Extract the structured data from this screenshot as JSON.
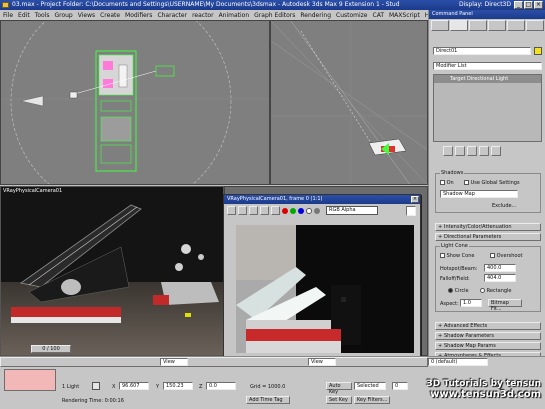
{
  "window": {
    "title": "03.max - Project Folder: C:\\Documents and Settings\\USERNAME\\My Documents\\3dsmax - Autodesk 3ds Max 9 Extension 1 - Stud",
    "display": "Display: Direct3D",
    "controls": [
      "_",
      "□",
      "×"
    ]
  },
  "menu": {
    "items": [
      "File",
      "Edit",
      "Tools",
      "Group",
      "Views",
      "Create",
      "Modifiers",
      "Character",
      "reactor",
      "Animation",
      "Graph Editors",
      "Rendering",
      "Customize",
      "CAT",
      "MAXScript",
      "Help"
    ]
  },
  "viewports": {
    "camera_label": "VRayPhysicalCamera01",
    "frame_slider": "0 / 100"
  },
  "vfb": {
    "title": "VRayPhysicalCamera01, frame 0 (1:1)",
    "channel": "RGB Alpha",
    "close": "×"
  },
  "command_panel": {
    "title": "Command Panel",
    "object_name": "Direct01",
    "modifier_list": "Modifier List",
    "stack_item": "Target Directional Light",
    "shadows": {
      "header": "Shadows",
      "on_label": "On",
      "global_label": "Use Global Settings",
      "type": "Shadow Map",
      "exclude": "Exclude..."
    },
    "rollouts": {
      "intensity": "Intensity/Color/Attenuation",
      "directional_params": "Directional Parameters",
      "advanced": "Advanced Effects",
      "shadow_params": "Shadow Parameters",
      "shadow_map": "Shadow Map Params",
      "atmospheres": "Atmospheres & Effects"
    },
    "light_cone": {
      "header": "Light Cone",
      "show_cone": "Show Cone",
      "overshoot": "Overshoot",
      "hotspot_label": "Hotspot/Beam:",
      "hotspot_value": "400.0",
      "falloff_label": "Falloff/Field:",
      "falloff_value": "404.0",
      "circle": "Circle",
      "rectangle": "Rectangle",
      "aspect_label": "Aspect:",
      "aspect_value": "1.0",
      "bitmap_fit": "Bitmap Fit..."
    }
  },
  "status": {
    "script_field": "",
    "selection": "1 Light",
    "x_label": "X",
    "x_value": "96.607",
    "y_label": "Y",
    "y_value": "150.23",
    "z_label": "Z",
    "z_value": "0.0",
    "grid": "Grid = 1000.0",
    "autokey": "Auto Key",
    "selected": "Selected",
    "setkey": "Set Key",
    "keyfilters": "Key Filters...",
    "add_time_tag": "Add Time Tag",
    "rendering_time": "Rendering Time: 0:00:16",
    "frame_value": "0",
    "layer": "0 (default)",
    "view_combo": "View",
    "render_combo": "View"
  },
  "watermark": {
    "line1": "3D Tutorials by tensun",
    "line2": "www.tensun3d.com"
  }
}
